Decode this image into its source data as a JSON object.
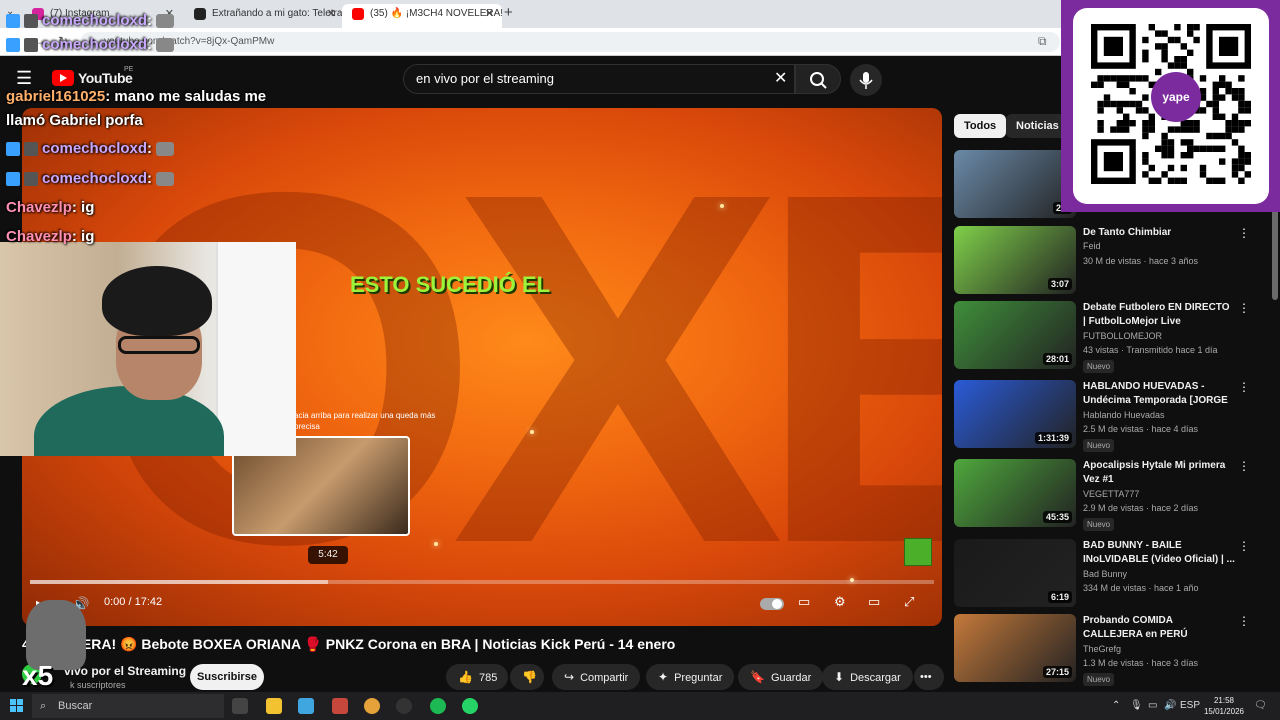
{
  "browser": {
    "tabs": [
      {
        "label": "(7) Instagram",
        "active": false
      },
      {
        "label": "Extrañando a mi gato: Teletrans",
        "active": false
      },
      {
        "label": "(35) 🔥 ¡M3CH4 NOVELERA! 🔴",
        "active": true
      }
    ],
    "new_tab": "+",
    "url": "youtube.com/watch?v=8jQx-QamPMw"
  },
  "youtube": {
    "logo_text": "YouTube",
    "region": "PE",
    "search_value": "en vivo por el streaming"
  },
  "player": {
    "overlay_text": "ESTO SUCEDIÓ EL",
    "hover_hint": "acia arriba para realizar una queda más precisa",
    "hover_time": "5:42",
    "timecode": "0:00 / 17:42",
    "progress_fraction": 0.0,
    "hover_fraction": 0.33
  },
  "video": {
    "title": "4 NOVELERA! 😡 Bebote BOXEA ORIANA 🥊 PNKZ Corona en BRA | Noticias Kick Perú - 14 enero",
    "channel": "vivo por el Streaming",
    "subs": "k suscriptores",
    "subscribe_label": "Suscribirse",
    "likes": "785",
    "share_label": "Compartir",
    "ask_label": "Preguntar",
    "save_label": "Guardar",
    "download_label": "Descargar",
    "more_label": "•••"
  },
  "sidebar": {
    "chips": [
      "Todos",
      "Noticias s"
    ],
    "recs": [
      {
        "title": "",
        "channel": "",
        "meta": "",
        "duration": "29:",
        "badge": "",
        "thumb_color": "#6a8aa8"
      },
      {
        "title": "De Tanto Chimbiar",
        "channel": "Feid",
        "meta": "30 M de vistas · hace 3 años",
        "duration": "3:07",
        "badge": "",
        "thumb_color": "#7fd04a"
      },
      {
        "title": "Debate Futbolero EN DIRECTO | FutbolLoMejor Live",
        "channel": "FUTBOLLOMEJOR",
        "meta": "43 vistas · Transmitido hace 1 día",
        "duration": "28:01",
        "badge": "Nuevo",
        "thumb_color": "#3f8f3a"
      },
      {
        "title": "HABLANDO HUEVADAS - Undécima Temporada [JORGE ...",
        "channel": "Hablando Huevadas",
        "meta": "2.5 M de vistas · hace 4 días",
        "duration": "1:31:39",
        "badge": "Nuevo",
        "thumb_color": "#2a5bd8"
      },
      {
        "title": "Apocalipsis Hytale Mi primera Vez #1",
        "channel": "VEGETTA777",
        "meta": "2.9 M de vistas · hace 2 días",
        "duration": "45:35",
        "badge": "Nuevo",
        "thumb_color": "#4ea83c"
      },
      {
        "title": "BAD BUNNY - BAILE INoLVIDABLE (Video Oficial) | ...",
        "channel": "Bad Bunny",
        "meta": "334 M de vistas · hace 1 año",
        "duration": "6:19",
        "badge": "",
        "thumb_color": "#1a1a1a"
      },
      {
        "title": "Probando COMIDA CALLEJERA en PERÚ",
        "channel": "TheGrefg",
        "meta": "1.3 M de vistas · hace 3 días",
        "duration": "27:15",
        "badge": "Nuevo",
        "thumb_color": "#c4793a"
      }
    ]
  },
  "chat": [
    {
      "user": "comechocloxd",
      "msg": ":",
      "color": "purple",
      "badge": true
    },
    {
      "user": "comechocloxd",
      "msg": ":",
      "color": "purple",
      "badge": true
    },
    {
      "user": "gabriel161025",
      "msg": ": mano me saludas me",
      "color": "orange",
      "badge": false
    },
    {
      "user": "",
      "msg": "llamó Gabriel porfa",
      "color": "none",
      "badge": false
    },
    {
      "user": "comechocloxd",
      "msg": ":",
      "color": "purple",
      "badge": true
    },
    {
      "user": "comechocloxd",
      "msg": ":",
      "color": "purple",
      "badge": true
    },
    {
      "user": "Chavezlp",
      "msg": ": ig",
      "color": "pink",
      "badge": false
    },
    {
      "user": "Chavezlp",
      "msg": ": ig",
      "color": "pink",
      "badge": false
    }
  ],
  "qr": {
    "logo": "yape"
  },
  "overlay": {
    "multiplier": "x5"
  },
  "taskbar": {
    "search_placeholder": "Buscar",
    "lang": "ESP",
    "time": "21:58",
    "date": "15/01/2026"
  },
  "colors": {
    "accent": "#ff0000",
    "qr_bg": "#7b2b9e",
    "overlay_green": "#9df23a"
  }
}
